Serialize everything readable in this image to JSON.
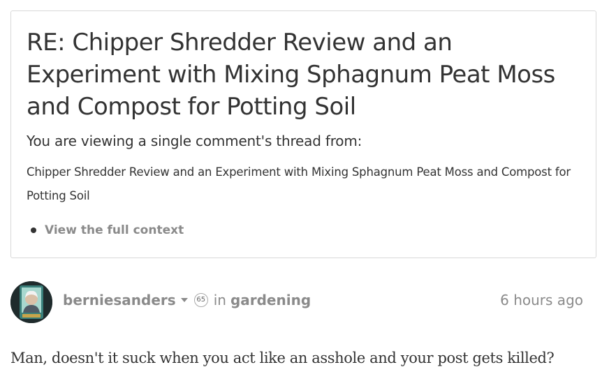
{
  "thread": {
    "title": "RE: Chipper Shredder Review and an Experiment with Mixing Sphagnum Peat Moss and Compost for Potting Soil",
    "viewing_text": "You are viewing a single comment's thread from:",
    "parent_post_title": "Chipper Shredder Review and an Experiment with Mixing Sphagnum Peat Moss and Compost for Potting Soil",
    "full_context_label": "View the full context"
  },
  "comment": {
    "author": "berniesanders",
    "reputation": "65",
    "in_word": "in",
    "community": "gardening",
    "timestamp": "6 hours ago",
    "body": "Man, doesn't it suck when you act like an asshole and your post gets killed?",
    "avatar_icon": "user-avatar-icon"
  }
}
